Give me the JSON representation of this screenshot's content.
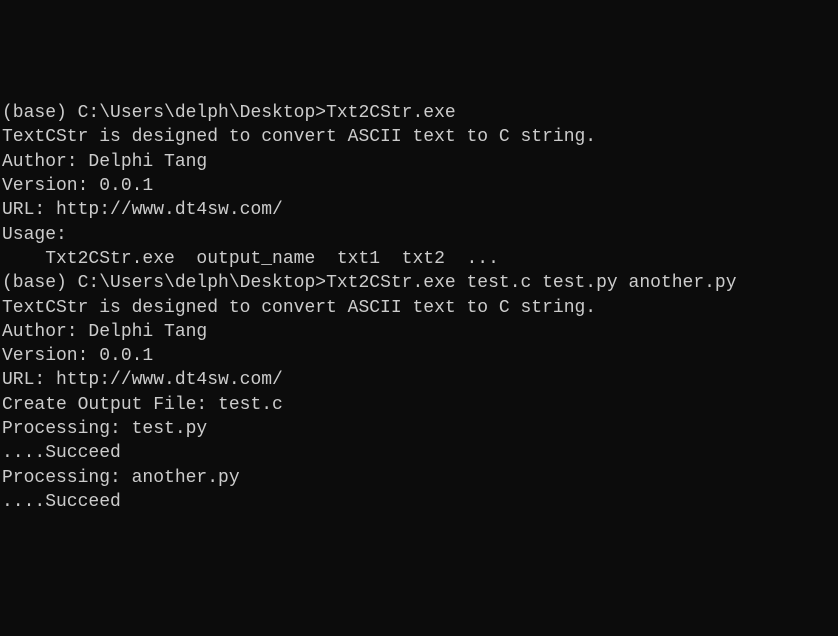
{
  "session1": {
    "prompt": "(base) C:\\Users\\delph\\Desktop>",
    "command": "Txt2CStr.exe",
    "banner1": "TextCStr is designed to convert ASCII text to C string.",
    "banner2": "Author: Delphi Tang",
    "banner3": "Version: 0.0.1",
    "banner4": "URL: http://www.dt4sw.com/",
    "blank1": "",
    "usage_hdr": "Usage:",
    "usage_line": "    Txt2CStr.exe  output_name  txt1  txt2  ...",
    "blank2": ""
  },
  "session2": {
    "prompt": "(base) C:\\Users\\delph\\Desktop>",
    "command": "Txt2CStr.exe test.c test.py another.py",
    "banner1": "TextCStr is designed to convert ASCII text to C string.",
    "banner2": "Author: Delphi Tang",
    "banner3": "Version: 0.0.1",
    "banner4": "URL: http://www.dt4sw.com/",
    "blank1": "",
    "create_out": "Create Output File: test.c",
    "blank2": "",
    "proc1": "Processing: test.py",
    "proc1_ok": "....Succeed",
    "proc2": "Processing: another.py",
    "proc2_ok": "....Succeed"
  }
}
